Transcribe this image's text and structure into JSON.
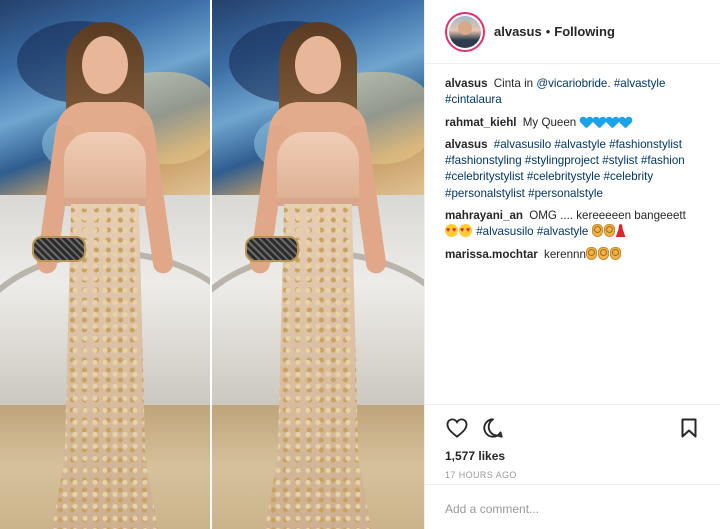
{
  "header": {
    "username": "alvasus",
    "separator": "•",
    "follow_status": "Following"
  },
  "caption": {
    "username": "alvasus",
    "text": "Cinta in",
    "mention": "@vicariobride.",
    "tags": "#alvastyle #cintalaura"
  },
  "comments": [
    {
      "username": "rahmat_kiehl",
      "text": "My Queen",
      "emoji": [
        "blue-heart",
        "blue-heart",
        "blue-heart",
        "blue-heart"
      ]
    },
    {
      "username": "alvasus",
      "tags": "#alvasusilo #alvastyle #fashionstylist #fashionstyling #stylingproject #stylist #fashion #celebritystylist #celebritystyle #celebrity #personalstylist #personalstyle"
    },
    {
      "username": "mahrayani_an",
      "text": "OMG .... kereeeeen bangeeett",
      "tags": "#alvasusilo #alvastyle",
      "emoji_before": [
        "heart-eyes",
        "heart-eyes"
      ],
      "emoji_after": [
        "ok-hand",
        "ok-hand",
        "dress"
      ]
    },
    {
      "username": "marissa.mochtar",
      "text": "kerennn",
      "emoji": [
        "ok-hand",
        "ok-hand",
        "ok-hand"
      ]
    }
  ],
  "actions": {
    "like_icon": "heart-outline-icon",
    "comment_icon": "speech-bubble-icon",
    "save_icon": "bookmark-icon"
  },
  "likes": "1,577 likes",
  "timestamp": "17 HOURS AGO",
  "add_comment": {
    "placeholder": "Add a comment..."
  },
  "colors": {
    "text": "#262626",
    "hashtag": "#003569",
    "muted": "#999999",
    "border": "#efefef",
    "avatar_ring": "#e1306c",
    "blue_heart": "#1aa3e8"
  }
}
